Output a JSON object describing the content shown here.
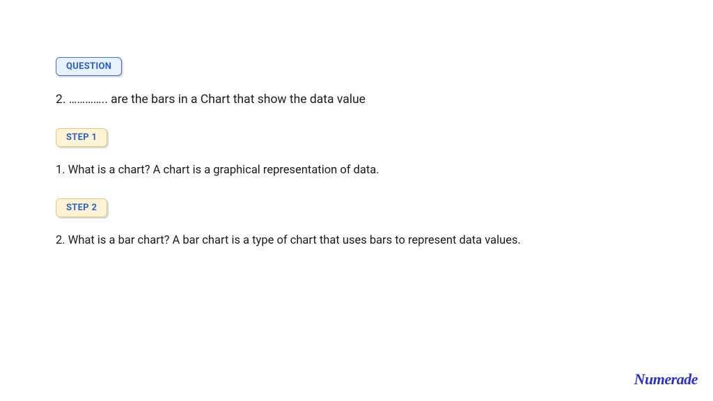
{
  "sections": [
    {
      "badge_label": "QUESTION",
      "text": "2. ………….. are the bars in a Chart that show the data value"
    },
    {
      "badge_label": "STEP 1",
      "text": "1. What is a chart? A chart is a graphical representation of data."
    },
    {
      "badge_label": "STEP 2",
      "text": "2. What is a bar chart? A bar chart is a type of chart that uses bars to represent data values."
    }
  ],
  "logo_text": "Numerade"
}
